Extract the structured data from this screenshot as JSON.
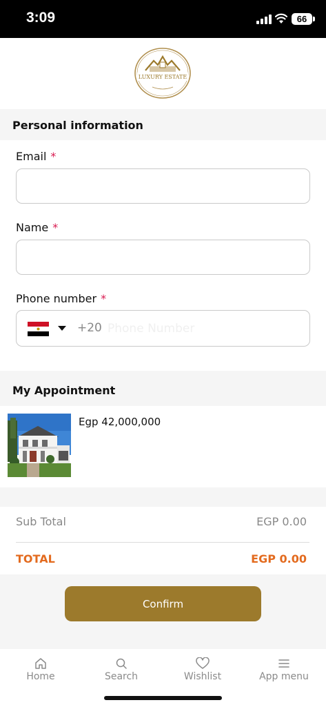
{
  "status_bar": {
    "time": "3:09",
    "battery": "66"
  },
  "logo": {
    "text": "LUXURY ESTATE"
  },
  "personal_info": {
    "title": "Personal information",
    "email": {
      "label": "Email",
      "required": "*",
      "value": ""
    },
    "name": {
      "label": "Name",
      "required": "*",
      "value": ""
    },
    "phone": {
      "label": "Phone number",
      "required": "*",
      "dial_code": "+20",
      "placeholder": "Phone Number",
      "value": ""
    }
  },
  "appointment": {
    "title": "My Appointment",
    "price": "Egp 42,000,000"
  },
  "summary": {
    "sub_total_label": "Sub Total",
    "sub_total_value": "EGP 0.00",
    "total_label": "TOTAL",
    "total_value": "EGP 0.00"
  },
  "confirm_label": "Confirm",
  "nav": {
    "items": [
      {
        "label": "Home",
        "icon": "home-icon"
      },
      {
        "label": "Search",
        "icon": "search-icon"
      },
      {
        "label": "Wishlist",
        "icon": "heart-icon"
      },
      {
        "label": "App menu",
        "icon": "menu-icon"
      }
    ]
  },
  "colors": {
    "accent": "#9c7a2c",
    "total": "#e36b1f",
    "required": "#d8194f"
  }
}
